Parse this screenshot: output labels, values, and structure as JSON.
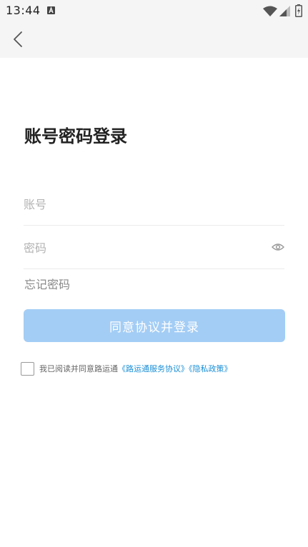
{
  "status_bar": {
    "time": "13:44",
    "icons": [
      "a-notification-icon",
      "wifi-icon",
      "signal-icon",
      "battery-charging-icon"
    ]
  },
  "toolbar": {
    "back_icon": "chevron-left-icon"
  },
  "page": {
    "title": "账号密码登录"
  },
  "form": {
    "account_placeholder": "账号",
    "account_value": "",
    "password_placeholder": "密码",
    "password_value": "",
    "password_toggle_icon": "eye-icon",
    "forgot_password": "忘记密码",
    "submit_label": "同意协议并登录"
  },
  "agreement": {
    "checked": false,
    "prefix": "我已阅读并同意路运通",
    "service_link": "《路运通服务协议》",
    "privacy_link": "《隐私政策》"
  },
  "colors": {
    "button_bg": "#a3cdf5",
    "link": "#1a8fd6",
    "header_bg": "#f5f5f5"
  }
}
